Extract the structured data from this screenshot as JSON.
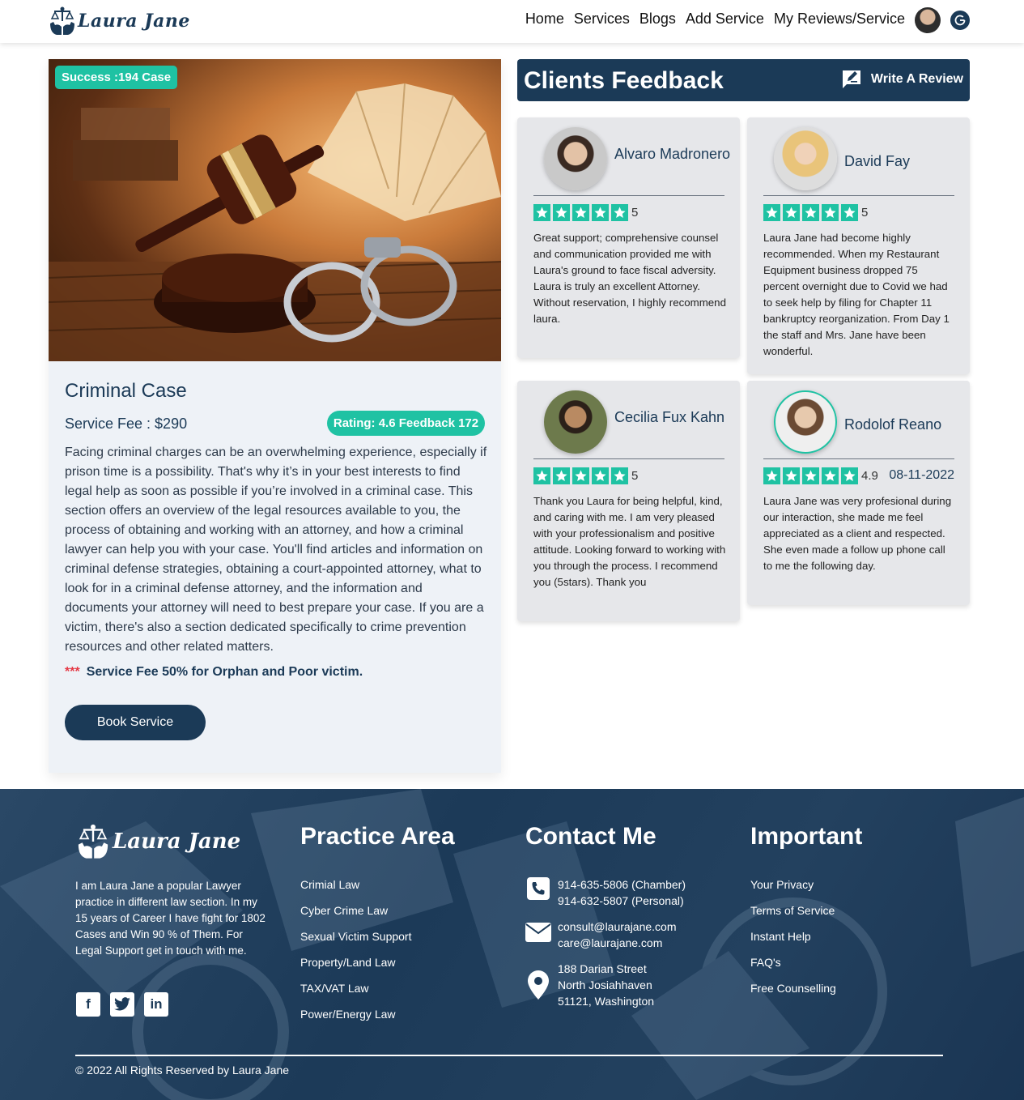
{
  "nav": {
    "logo_text": "Laura Jane",
    "links": [
      "Home",
      "Services",
      "Blogs",
      "Add Service",
      "My Reviews/Service"
    ]
  },
  "service": {
    "badge": "Success :194 Case",
    "title": "Criminal Case",
    "fee": "Service Fee : $290",
    "rating_badge": "Rating: 4.6 Feedback 172",
    "description": "Facing criminal charges can be an overwhelming experience, especially if prison time is a possibility. That's why it’s in your best interests to find legal help as soon as possible if you’re involved in a criminal case. This section offers an overview of the legal resources available to you, the process of obtaining and working with an attorney, and how a criminal lawyer can help you with your case. You'll find articles and information on criminal defense strategies, obtaining a court-appointed attorney, what to look for in a criminal defense attorney, and the information and documents your attorney will need to best prepare your case. If you are a victim, there's also a section dedicated specifically to crime prevention resources and other related matters.",
    "note_marker": "***",
    "note": "Service Fee 50% for Orphan and Poor victim.",
    "book_label": "Book Service"
  },
  "feedback": {
    "title": "Clients Feedback",
    "write_label": "Write A Review",
    "reviews": [
      {
        "name": "Alvaro Madronero",
        "score": "5",
        "stars": 5,
        "date": "",
        "text": "Great support; comprehensive counsel and communication provided me with Laura's ground to face fiscal adversity. Laura is truly an excellent Attorney. Without reservation, I highly recommend laura."
      },
      {
        "name": "David Fay",
        "score": "5",
        "stars": 5,
        "date": "",
        "text": "Laura Jane had become highly recommended. When my Restaurant Equipment business dropped 75 percent overnight due to Covid we had to seek help by filing for Chapter 11 bankruptcy reorganization. From Day 1 the staff and Mrs. Jane have been wonderful."
      },
      {
        "name": "Cecilia Fux Kahn",
        "score": "5",
        "stars": 5,
        "date": "",
        "text": "Thank you Laura for being helpful, kind, and caring with me. I am very pleased with your professionalism and positive attitude. Looking forward to working with you through the process. I recommend you (5stars). Thank you"
      },
      {
        "name": "Rodolof Reano",
        "score": "4.9",
        "stars": 5,
        "date": "08-11-2022",
        "text": "Laura Jane was very profesional during our interaction, she made me feel appreciated as a client and respected. She even made a follow up phone call to me the following day."
      }
    ]
  },
  "footer": {
    "logo_text": "Laura Jane",
    "about": "I am Laura Jane a popular Lawyer practice in different law section. In my 15 years of Career I have fight for 1802 Cases and Win 90 % of Them. For Legal Support get in touch with me.",
    "social_icons": [
      "facebook-icon",
      "twitter-icon",
      "linkedin-icon"
    ],
    "practice_title": "Practice Area",
    "practice_items": [
      "Crimial Law",
      "Cyber Crime Law",
      "Sexual Victim Support",
      "Property/Land Law",
      "TAX/VAT Law",
      "Power/Energy Law"
    ],
    "contact_title": "Contact Me",
    "phone_lines": [
      "914-635-5806 (Chamber)",
      "914-632-5807 (Personal)"
    ],
    "email_lines": [
      "consult@laurajane.com",
      "care@laurajane.com"
    ],
    "address_lines": [
      "188 Darian Street",
      "North Josiahhaven",
      "51121, Washington"
    ],
    "important_title": "Important",
    "important_items": [
      "Your Privacy",
      "Terms of Service",
      "Instant Help",
      "FAQ's",
      "Free Counselling"
    ],
    "copyright": "© 2022 All Rights Reserved by Laura Jane"
  },
  "colors": {
    "navy": "#1b3a57",
    "teal": "#1fc2a3",
    "red": "#e53945"
  }
}
